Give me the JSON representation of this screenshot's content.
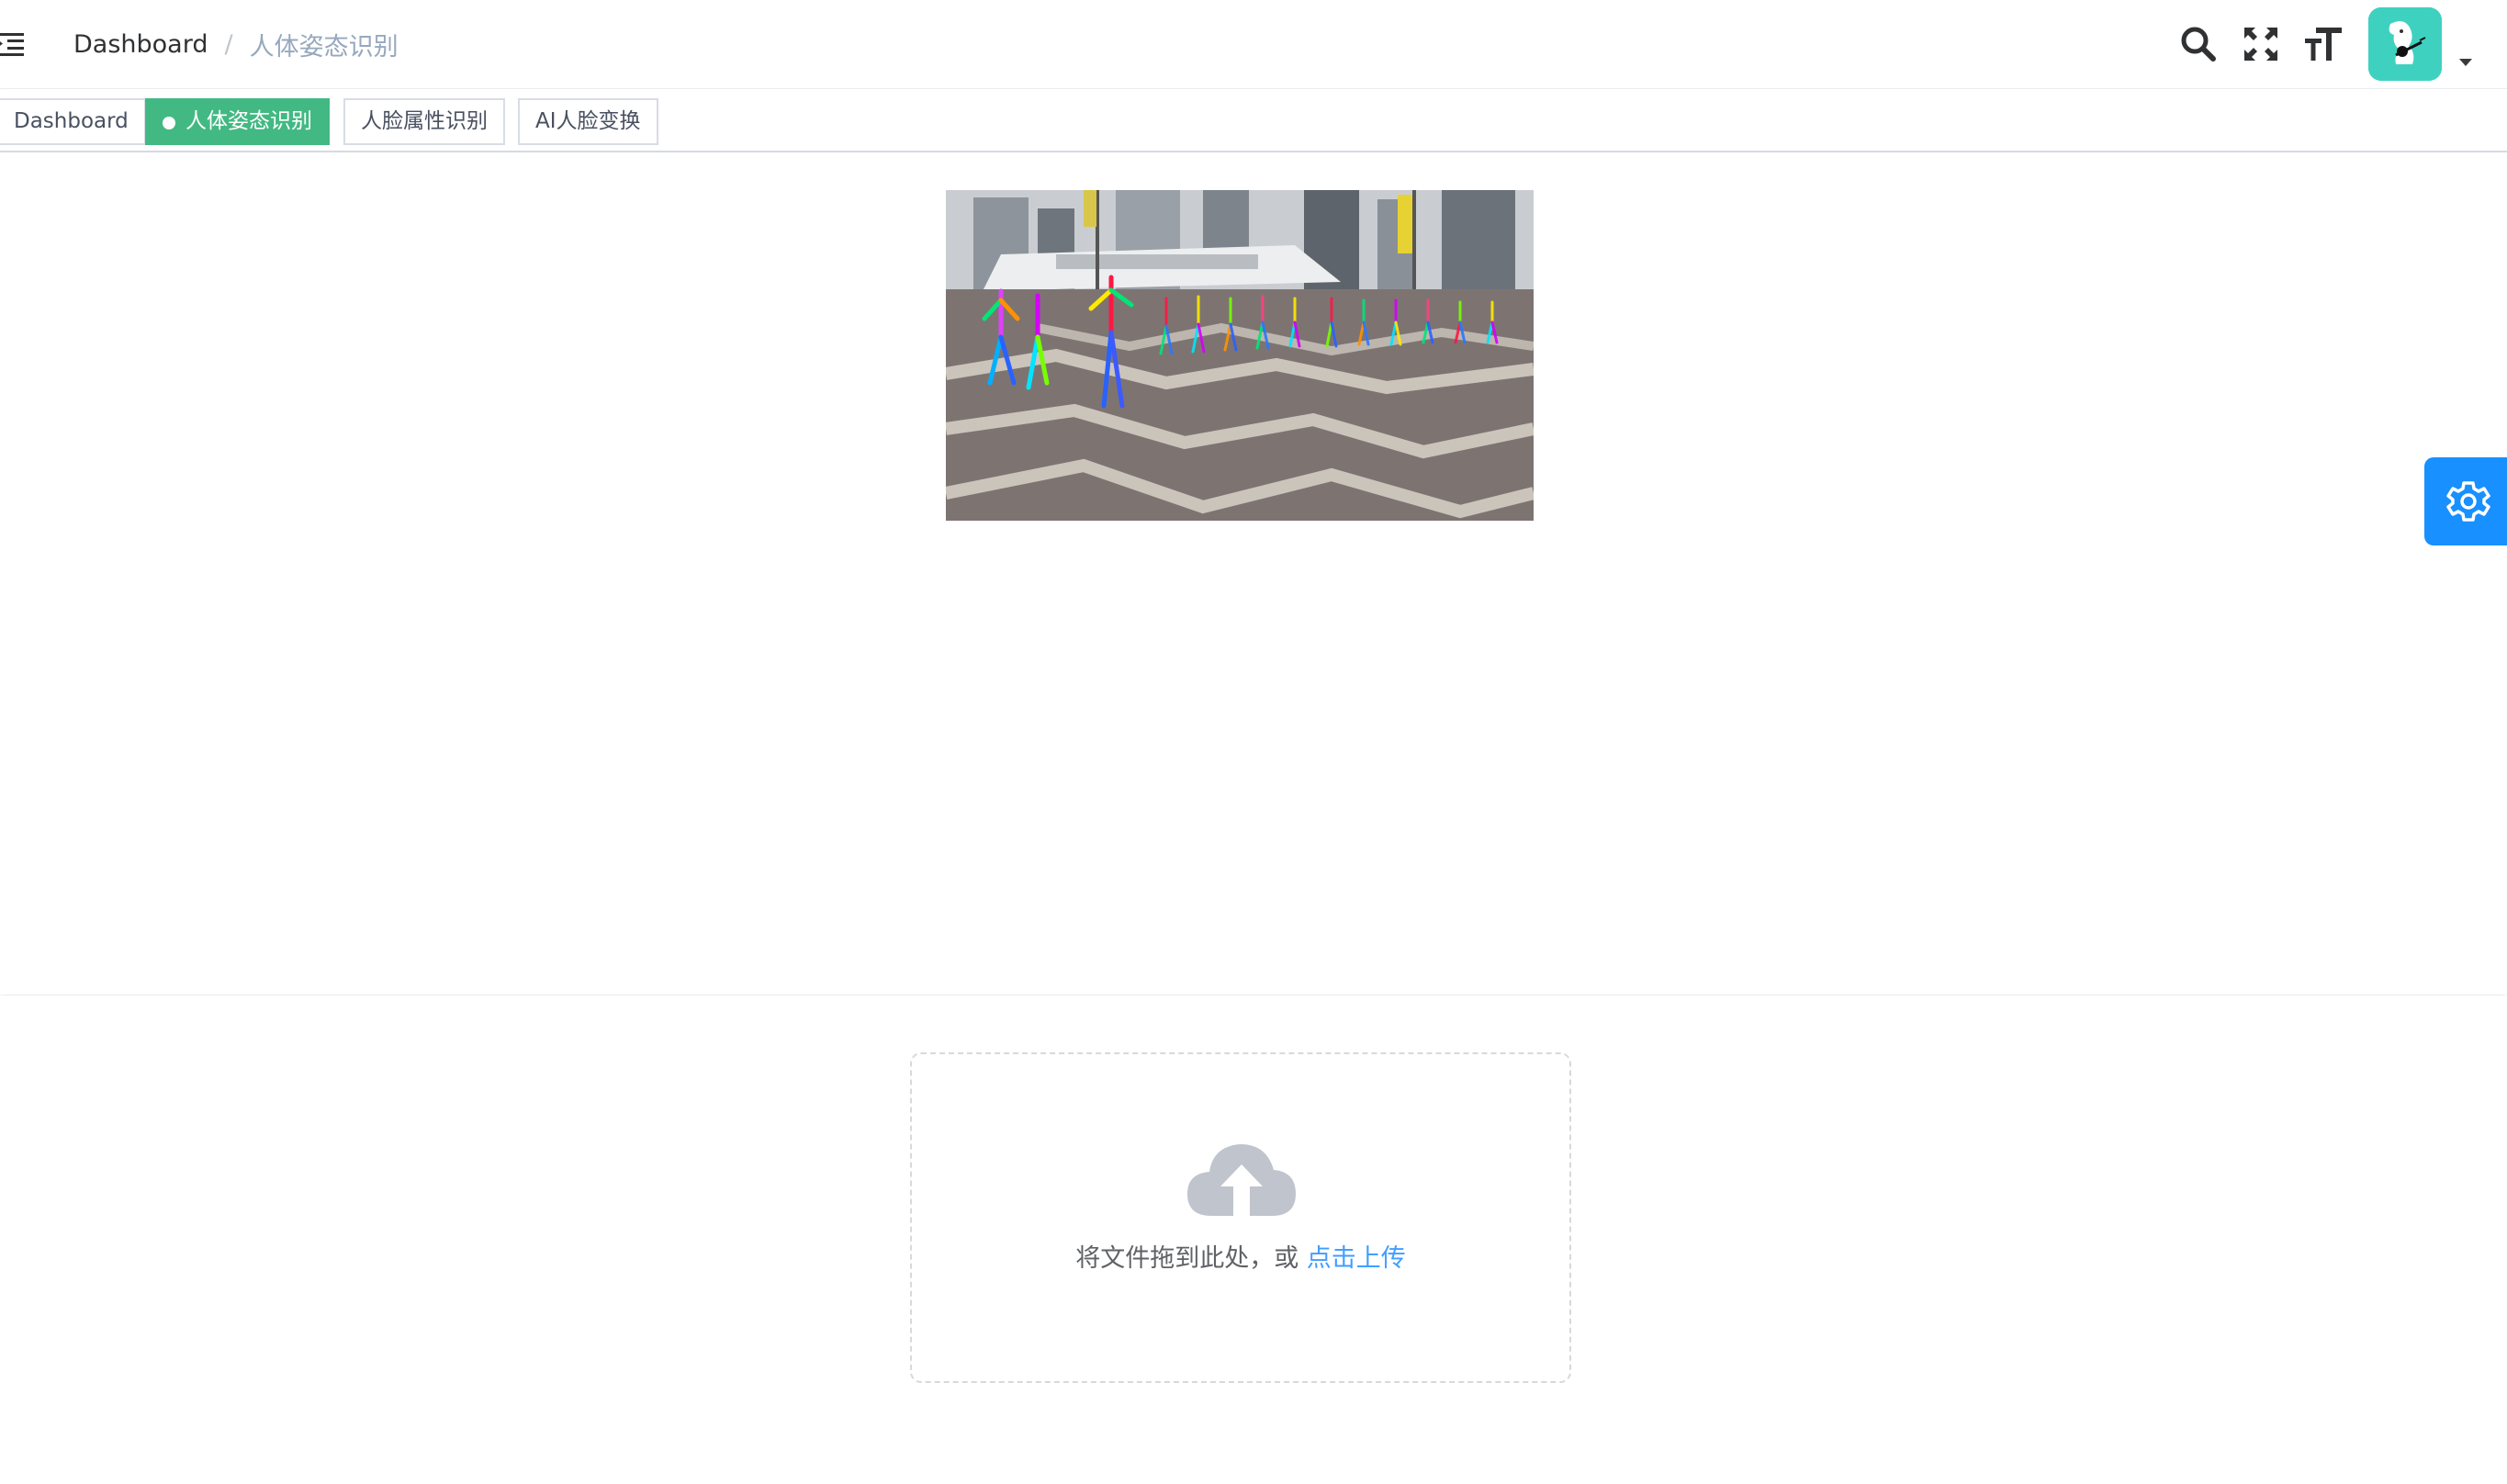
{
  "breadcrumb": {
    "root": "Dashboard",
    "separator": "/",
    "current": "人体姿态识别"
  },
  "navbar": {
    "icons": [
      "hamburger-icon",
      "search-icon",
      "fullscreen-icon",
      "text-size-icon",
      "avatar",
      "caret-down-icon"
    ]
  },
  "tags": [
    {
      "label": "Dashboard",
      "active": false
    },
    {
      "label": "人体姿态识别",
      "active": true
    },
    {
      "label": "人脸属性识别",
      "active": false
    },
    {
      "label": "AI人脸变换",
      "active": false
    }
  ],
  "upload": {
    "text": "将文件拖到此处，或",
    "link": "点击上传"
  },
  "colors": {
    "active_tag": "#42b983",
    "settings_button": "#1890ff",
    "upload_link": "#409eff",
    "avatar_bg": "#3fd1c0"
  }
}
